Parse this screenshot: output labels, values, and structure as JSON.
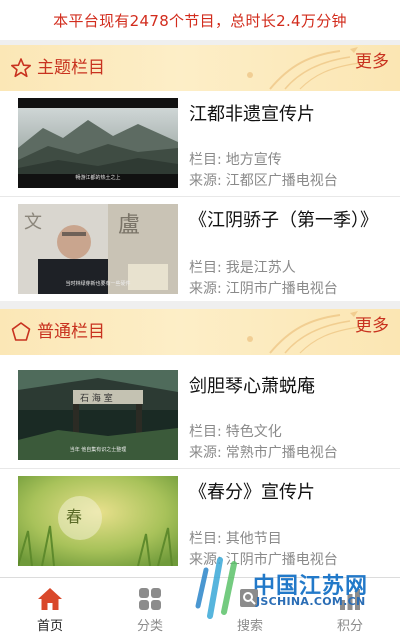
{
  "banner": {
    "text": "本平台现有2478个节目，总时长2.4万分钟"
  },
  "sections": [
    {
      "title": "主题栏目",
      "more": "更多",
      "items": [
        {
          "title": "江都非遗宣传片",
          "column_label": "栏目:",
          "column": "地方宣传",
          "source_label": "来源:",
          "source": "江都区广播电视台",
          "caption": "畅游江都的热土之上"
        },
        {
          "title": "《江阴骄子（第一季）》",
          "column_label": "栏目:",
          "column": "我是江苏人",
          "source_label": "来源:",
          "source": "江阴市广播电视台",
          "caption": "当时林绿芽新也要有一些硬件"
        }
      ]
    },
    {
      "title": "普通栏目",
      "more": "更多",
      "items": [
        {
          "title": "剑胆琴心萧蜕庵",
          "column_label": "栏目:",
          "column": "特色文化",
          "source_label": "来源:",
          "source": "常熟市广播电视台",
          "caption": "当年 他自集有识之士整理"
        },
        {
          "title": "《春分》宣传片",
          "column_label": "栏目:",
          "column": "其他节目",
          "source_label": "来源:",
          "source": "江阴市广播电视台",
          "caption": ""
        }
      ]
    }
  ],
  "tabs": [
    {
      "label": "首页",
      "icon": "home-icon",
      "active": true
    },
    {
      "label": "分类",
      "icon": "grid-icon",
      "active": false
    },
    {
      "label": "搜索",
      "icon": "search-icon",
      "active": false
    },
    {
      "label": "积分",
      "icon": "points-icon",
      "active": false
    }
  ],
  "watermark": {
    "text": "中国江苏网",
    "sub": "JSCHINA.COM.CN"
  },
  "colors": {
    "accent": "#c8321f",
    "banner_text": "#d22c1d",
    "header_bg": "#fbe7b6",
    "meta_text": "#8a8a8a"
  }
}
